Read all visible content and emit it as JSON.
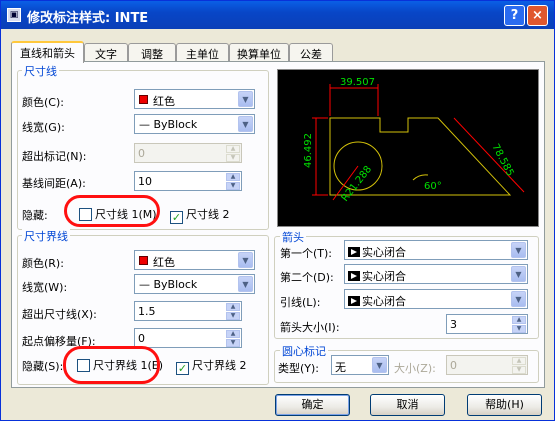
{
  "window": {
    "title": "修改标注样式: INTE",
    "help_glyph": "?",
    "close_glyph": "×"
  },
  "tabs": [
    "直线和箭头",
    "文字",
    "调整",
    "主单位",
    "换算单位",
    "公差"
  ],
  "dim_lines": {
    "title": "尺寸线",
    "color_label": "颜色(C):",
    "color_value": "红色",
    "lineweight_label": "线宽(G):",
    "lineweight_value": "— ByBlock",
    "extend_label": "超出标记(N):",
    "extend_value": "0",
    "baseline_label": "基线间距(A):",
    "baseline_value": "10",
    "suppress_label": "隐藏:",
    "suppress_1": "尺寸线 1(M)",
    "suppress_2": "尺寸线 2",
    "suppress_1_checked": false,
    "suppress_2_checked": true
  },
  "ext_lines": {
    "title": "尺寸界线",
    "color_label": "颜色(R):",
    "color_value": "红色",
    "lineweight_label": "线宽(W):",
    "lineweight_value": "— ByBlock",
    "extend_label": "超出尺寸线(X):",
    "extend_value": "1.5",
    "offset_label": "起点偏移量(F):",
    "offset_value": "0",
    "suppress_label": "隐藏(S):",
    "suppress_1": "尺寸界线 1(E)",
    "suppress_2": "尺寸界线 2",
    "suppress_1_checked": false,
    "suppress_2_checked": true
  },
  "preview": {
    "dim_top": "39.507",
    "dim_left": "46.492",
    "dim_right": "78.585",
    "dim_radius": "R21.288",
    "dim_angle": "60°",
    "line_color": "#d4c20a",
    "dim_color": "#00e000",
    "dimline_color": "#ff0000"
  },
  "arrows": {
    "title": "箭头",
    "first_label": "第一个(T):",
    "first_value": "实心闭合",
    "second_label": "第二个(D):",
    "second_value": "实心闭合",
    "leader_label": "引线(L):",
    "leader_value": "实心闭合",
    "size_label": "箭头大小(I):",
    "size_value": "3"
  },
  "center": {
    "title": "圆心标记",
    "type_label": "类型(Y):",
    "type_value": "无",
    "size_label": "大小(Z):",
    "size_value": "0"
  },
  "buttons": {
    "ok": "确定",
    "cancel": "取消",
    "help": "帮助(H)"
  },
  "colors": {
    "title_bar": "#0a5fe6",
    "group_title": "#0046d5",
    "swatch_red": "#ee0000",
    "highlight": "#ff1010"
  }
}
